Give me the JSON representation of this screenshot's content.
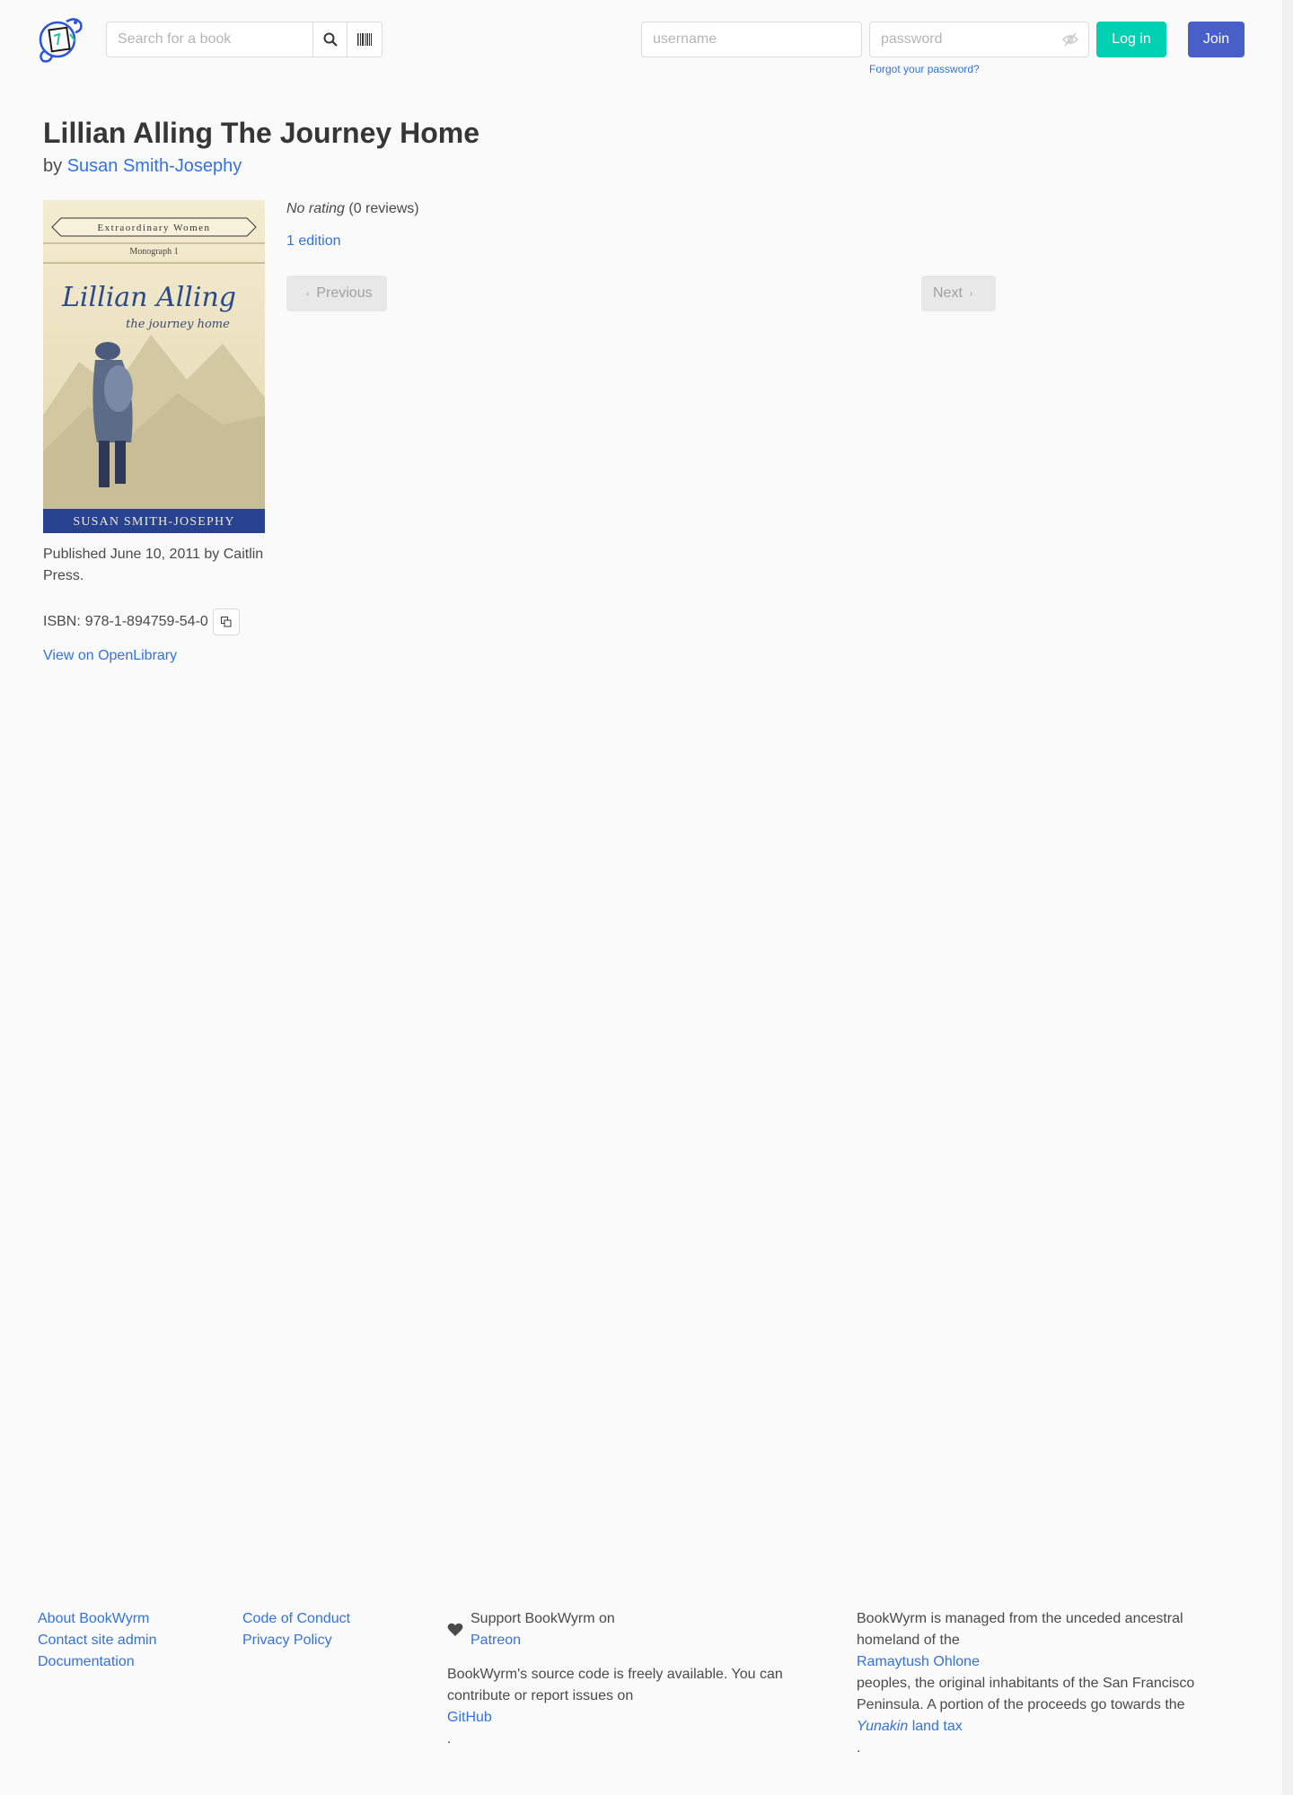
{
  "header": {
    "search": {
      "placeholder": "Search for a book",
      "value": ""
    },
    "login": {
      "username_placeholder": "username",
      "password_placeholder": "password",
      "forgot_label": "Forgot your password?",
      "login_label": "Log in",
      "join_label": "Join"
    }
  },
  "book": {
    "title": "Lillian Alling The Journey Home",
    "by_prefix": "by",
    "author": "Susan Smith-Josephy",
    "cover": {
      "series_banner": "Extraordinary Women",
      "monograph": "Monograph 1",
      "cover_title": "Lillian Alling",
      "cover_subtitle": "the journey home",
      "cover_author": "SUSAN SMITH-JOSEPHY"
    },
    "published": "Published June 10, 2011 by Caitlin Press.",
    "isbn_label": "ISBN:",
    "isbn": "978-1-894759-54-0",
    "openlibrary_label": "View on OpenLibrary",
    "rating_label": "No rating",
    "reviews_count": "(0 reviews)",
    "editions_label": "1 edition",
    "pagination": {
      "previous_label": "Previous",
      "next_label": "Next"
    }
  },
  "footer": {
    "col1": [
      "About BookWyrm",
      "Contact site admin",
      "Documentation"
    ],
    "col2": [
      "Code of Conduct",
      "Privacy Policy"
    ],
    "support": {
      "prefix": "Support BookWyrm on",
      "link": "Patreon"
    },
    "source": {
      "prefix": "BookWyrm's source code is freely available. You can contribute or report issues on",
      "link": "GitHub",
      "suffix": "."
    },
    "land": {
      "p1": "BookWyrm is managed from the unceded ancestral homeland of the",
      "l1": "Ramaytush Ohlone",
      "p2": "peoples, the original inhabitants of the San Francisco Peninsula. A portion of the proceeds go towards the",
      "l2_italic": "Yunakin",
      "l2": "land tax",
      "p3": "."
    }
  },
  "colors": {
    "link": "#3273dc",
    "login": "#00d1b2",
    "join": "#485fc7",
    "cover_band": "#27428f"
  }
}
